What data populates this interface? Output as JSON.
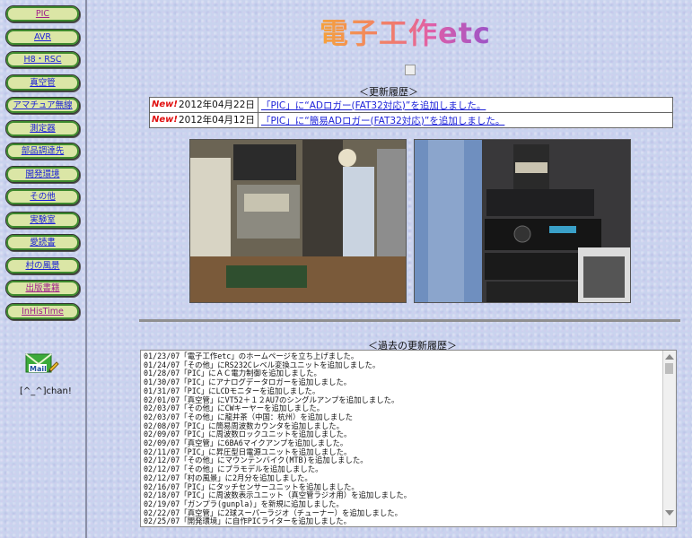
{
  "sidebar": {
    "items": [
      {
        "label": "PIC",
        "color": "purple"
      },
      {
        "label": "AVR",
        "color": "blue"
      },
      {
        "label": "H8・RSC",
        "color": "blue"
      },
      {
        "label": "真空管",
        "color": "blue"
      },
      {
        "label": "アマチュア無線",
        "color": "blue"
      },
      {
        "label": "測定器",
        "color": "blue"
      },
      {
        "label": "部品調達先",
        "color": "blue"
      },
      {
        "label": "開発環境",
        "color": "blue"
      },
      {
        "label": "その他",
        "color": "blue"
      },
      {
        "label": "実験室",
        "color": "blue"
      },
      {
        "label": "愛読書",
        "color": "blue"
      },
      {
        "label": "村の風景",
        "color": "blue"
      },
      {
        "label": "出版書籍",
        "color": "purple"
      },
      {
        "label": "InHisTime",
        "color": "purple"
      }
    ],
    "mail_icon": "mail-icon",
    "mail_label": "Mail",
    "signature": "[^_^]chan!"
  },
  "header": {
    "logo_text": "電子工作etc"
  },
  "updates": {
    "heading": "＜更新履歴＞",
    "badge": "New!",
    "rows": [
      {
        "date": "2012年04月22日",
        "text": "「PIC」に“ADロガー(FAT32対応)”を追加しました。"
      },
      {
        "date": "2012年04月12日",
        "text": "「PIC」に“簡易ADロガー(FAT32対応)”を追加しました。"
      }
    ]
  },
  "past": {
    "heading": "＜過去の更新履歴＞",
    "lines": [
      "01/23/07「電子工作etc」のホームページを立ち上げました。",
      "01/24/07「その他」にRS232Cレベル変換ユニットを追加しました。",
      "01/28/07「PIC」にＡＣ電力制御を追加しました。",
      "01/30/07「PIC」にアナログデータロガーを追加しました。",
      "01/31/07「PIC」にLCDモニターを追加しました。",
      "02/01/07「真空管」にVT52＋１２AU7のシングルアンプを追加しました。",
      "02/03/07「その他」にCWキーヤーを追加しました。",
      "02/03/07「その他」に龍井茶（中国：杭州）を追加しました",
      "02/08/07「PIC」に簡易周波数カウンタを追加しました。",
      "02/09/07「PIC」に周波数ロックユニットを追加しました。",
      "02/09/07「真空管」に6BA6マイクアンプを追加しました。",
      "02/11/07「PIC」に昇圧型日電源ユニットを追加しました。",
      "02/12/07「その他」にマウンテンバイク(MTB)を追加しました。",
      "02/12/07「その他」にプラモデルを追加しました。",
      "02/12/07「村の風景」に2月分を追加しました。",
      "02/16/07「PIC」にタッチセンサーユニットを追加しました。",
      "02/18/07「PIC」に周波数表示ユニット（真空管ラジオ用）を追加しました。",
      "02/19/07「ガンプラ(gunpla)」を新規に追加しました。",
      "02/22/07「真空管」に2球スーパーラジオ（チューナー）を追加しました。",
      "02/25/07「開発環境」に自作PICライターを追加しました。"
    ]
  },
  "colors": {
    "nav_link": "#1a1fd8",
    "nav_visited": "#a0208a",
    "new_badge": "#e01010"
  }
}
